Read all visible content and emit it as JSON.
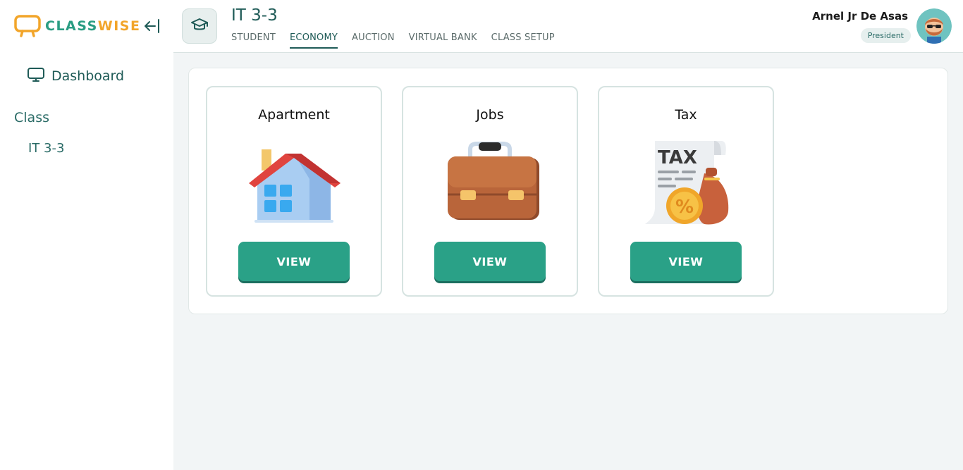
{
  "brand": {
    "part1": "CLASS",
    "part2": "WISE"
  },
  "sidebar": {
    "dashboard_label": "Dashboard",
    "class_heading": "Class",
    "class_items": [
      "IT 3-3"
    ]
  },
  "header": {
    "class_title": "IT 3-3",
    "tabs": [
      {
        "label": "STUDENT"
      },
      {
        "label": "ECONOMY"
      },
      {
        "label": "AUCTION"
      },
      {
        "label": "VIRTUAL BANK"
      },
      {
        "label": "CLASS SETUP"
      }
    ],
    "active_tab": "ECONOMY",
    "user_name": "Arnel Jr De Asas",
    "user_role": "President"
  },
  "cards": [
    {
      "title": "Apartment",
      "icon": "house-icon",
      "button_label": "VIEW"
    },
    {
      "title": "Jobs",
      "icon": "briefcase-icon",
      "button_label": "VIEW"
    },
    {
      "title": "Tax",
      "icon": "tax-document-icon",
      "button_label": "VIEW"
    }
  ],
  "colors": {
    "primary": "#2aa187",
    "brand_green": "#2a9d83",
    "brand_orange": "#f2a52a",
    "text_teal": "#1f5b57"
  }
}
